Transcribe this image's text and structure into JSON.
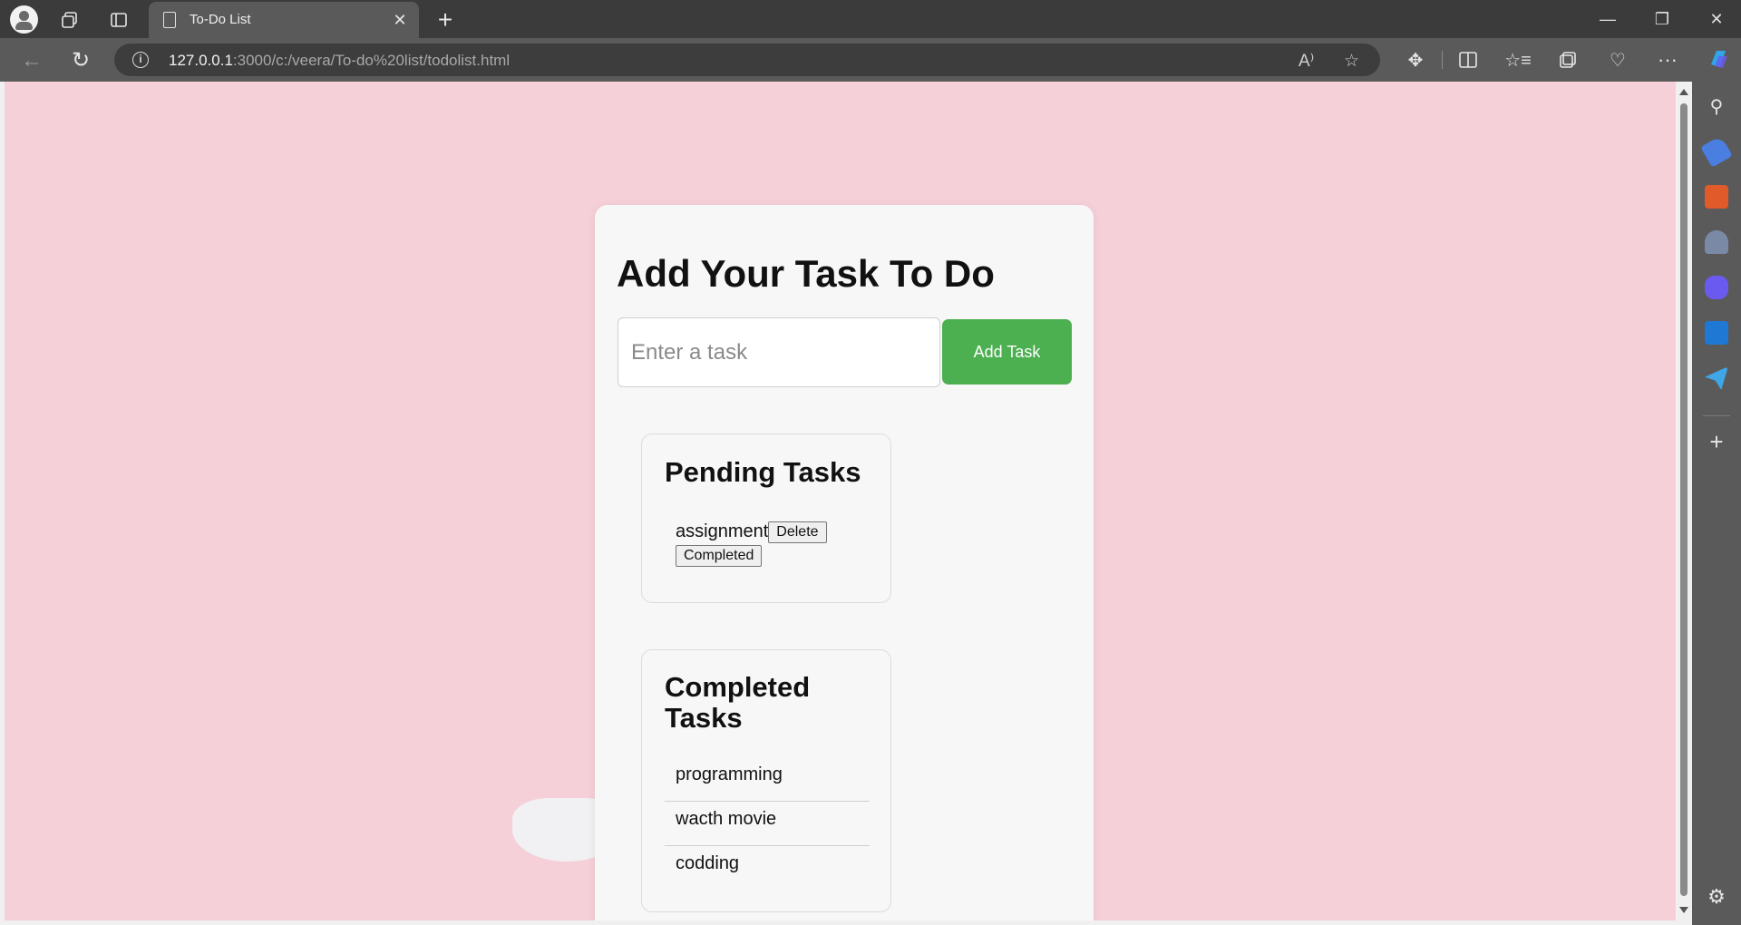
{
  "browser": {
    "tab_title": "To-Do List",
    "url_host": "127.0.0.1",
    "url_rest": ":3000/c:/veera/To-do%20list/todolist.html"
  },
  "app": {
    "heading": "Add Your Task To Do",
    "input_placeholder": "Enter a task",
    "input_value": "",
    "add_button_label": "Add Task"
  },
  "pending": {
    "title": "Pending Tasks",
    "items": [
      {
        "text": "assignment",
        "delete_label": "Delete",
        "complete_label": "Completed"
      }
    ]
  },
  "completed": {
    "title": "Completed Tasks",
    "items": [
      {
        "text": "programming"
      },
      {
        "text": "wacth movie"
      },
      {
        "text": "codding"
      }
    ]
  },
  "colors": {
    "page_background": "#f5d0d8",
    "card_background": "#f7f7f7",
    "add_button": "#4caf50"
  }
}
